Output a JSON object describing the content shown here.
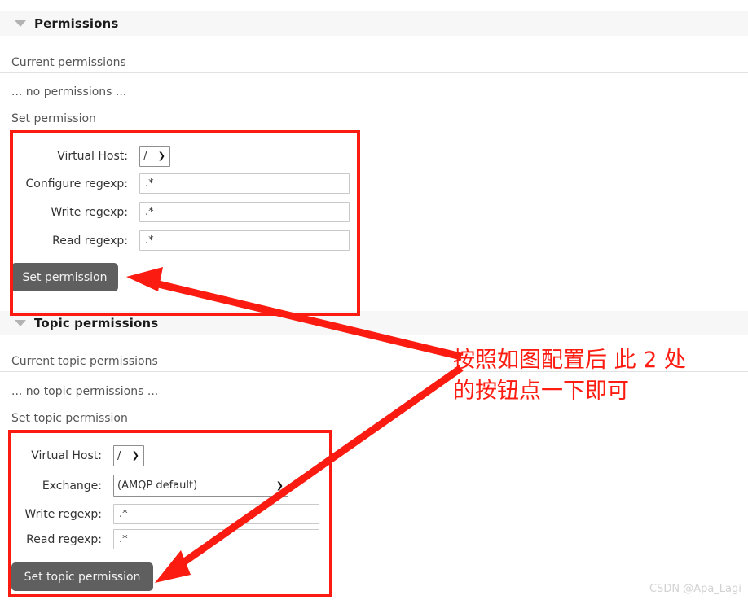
{
  "permissions_section": {
    "title": "Permissions",
    "collapse_icon": "triangle-down-icon",
    "current_label": "Current permissions",
    "empty_text": "... no permissions ...",
    "set_label": "Set permission",
    "form": {
      "rows": [
        {
          "label": "Virtual Host:",
          "type": "select",
          "value": "/"
        },
        {
          "label": "Configure regexp:",
          "type": "text",
          "value": ".*"
        },
        {
          "label": "Write regexp:",
          "type": "text",
          "value": ".*"
        },
        {
          "label": "Read regexp:",
          "type": "text",
          "value": ".*"
        }
      ],
      "submit_label": "Set permission"
    }
  },
  "topic_permissions_section": {
    "title": "Topic permissions",
    "collapse_icon": "triangle-down-icon",
    "current_label": "Current topic permissions",
    "empty_text": "... no topic permissions ...",
    "set_label": "Set topic permission",
    "form": {
      "rows": [
        {
          "label": "Virtual Host:",
          "type": "select",
          "value": "/"
        },
        {
          "label": "Exchange:",
          "type": "select",
          "value": "(AMQP default)"
        },
        {
          "label": "Write regexp:",
          "type": "text",
          "value": ".*"
        },
        {
          "label": "Read regexp:",
          "type": "text",
          "value": ".*"
        }
      ],
      "submit_label": "Set topic permission"
    }
  },
  "annotation": {
    "line1": "按照如图配置后 此 2 处",
    "line2": "的按钮点一下即可",
    "color": "#fd1c11"
  },
  "watermark": {
    "text": "CSDN @Apa_Lagi"
  }
}
